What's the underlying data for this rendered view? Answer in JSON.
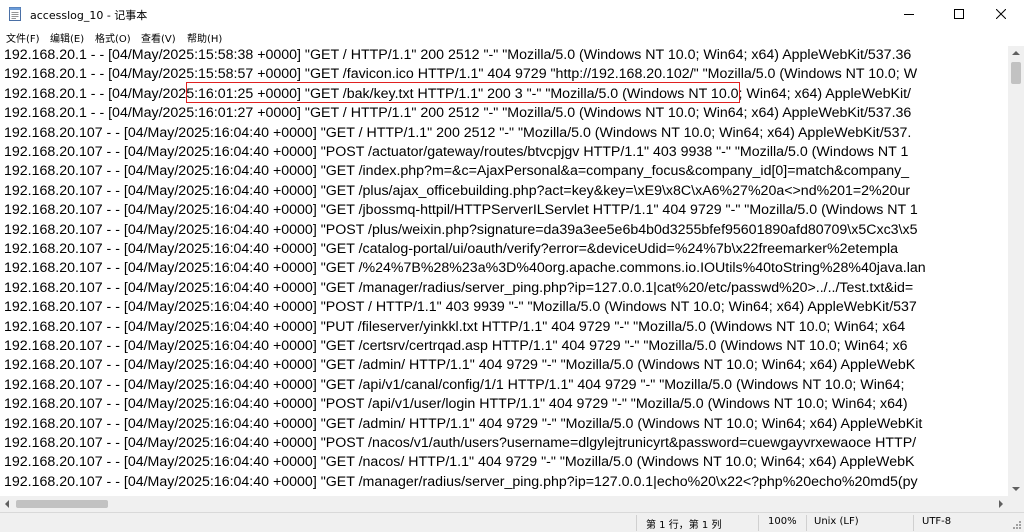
{
  "window": {
    "title": "accesslog_10 - 记事本"
  },
  "menu": [
    {
      "label": "文件(F)"
    },
    {
      "label": "编辑(E)"
    },
    {
      "label": "格式(O)"
    },
    {
      "label": "查看(V)"
    },
    {
      "label": "帮助(H)"
    }
  ],
  "editor": {
    "lines": [
      "192.168.20.1 - - [04/May/2025:15:58:38 +0000] \"GET / HTTP/1.1\" 200 2512 \"-\" \"Mozilla/5.0 (Windows NT 10.0; Win64; x64) AppleWebKit/537.36",
      "192.168.20.1 - - [04/May/2025:15:58:57 +0000] \"GET /favicon.ico HTTP/1.1\" 404 9729 \"http://192.168.20.102/\" \"Mozilla/5.0 (Windows NT 10.0; W",
      "192.168.20.1 - - [04/May/2025:16:01:25 +0000] \"GET /bak/key.txt HTTP/1.1\" 200 3 \"-\" \"Mozilla/5.0 (Windows NT 10.0; Win64; x64) AppleWebKit/",
      "192.168.20.1 - - [04/May/2025:16:01:27 +0000] \"GET / HTTP/1.1\" 200 2512 \"-\" \"Mozilla/5.0 (Windows NT 10.0; Win64; x64) AppleWebKit/537.36",
      "192.168.20.107 - - [04/May/2025:16:04:40 +0000] \"GET / HTTP/1.1\" 200 2512 \"-\" \"Mozilla/5.0 (Windows NT 10.0; Win64; x64) AppleWebKit/537.",
      "192.168.20.107 - - [04/May/2025:16:04:40 +0000] \"POST /actuator/gateway/routes/btvcpjgv HTTP/1.1\" 403 9938 \"-\" \"Mozilla/5.0 (Windows NT 1",
      "192.168.20.107 - - [04/May/2025:16:04:40 +0000] \"GET /index.php?m=&c=AjaxPersonal&a=company_focus&company_id[0]=match&company_",
      "192.168.20.107 - - [04/May/2025:16:04:40 +0000] \"GET /plus/ajax_officebuilding.php?act=key&key=\\xE9\\x8C\\xA6%27%20a<>nd%201=2%20ur",
      "192.168.20.107 - - [04/May/2025:16:04:40 +0000] \"GET /jbossmq-httpil/HTTPServerILServlet HTTP/1.1\" 404 9729 \"-\" \"Mozilla/5.0 (Windows NT 1",
      "192.168.20.107 - - [04/May/2025:16:04:40 +0000] \"POST /plus/weixin.php?signature=da39a3ee5e6b4b0d3255bfef95601890afd80709\\x5Cxc3\\x5",
      "192.168.20.107 - - [04/May/2025:16:04:40 +0000] \"GET /catalog-portal/ui/oauth/verify?error=&deviceUdid=%24%7b\\x22freemarker%2etempla",
      "192.168.20.107 - - [04/May/2025:16:04:40 +0000] \"GET /%24%7B%28%23a%3D%40org.apache.commons.io.IOUtils%40toString%28%40java.lan",
      "192.168.20.107 - - [04/May/2025:16:04:40 +0000] \"GET /manager/radius/server_ping.php?ip=127.0.0.1|cat%20/etc/passwd%20>../../Test.txt&id=",
      "192.168.20.107 - - [04/May/2025:16:04:40 +0000] \"POST / HTTP/1.1\" 403 9939 \"-\" \"Mozilla/5.0 (Windows NT 10.0; Win64; x64) AppleWebKit/537",
      "192.168.20.107 - - [04/May/2025:16:04:40 +0000] \"PUT /fileserver/yinkkl.txt HTTP/1.1\" 404 9729 \"-\" \"Mozilla/5.0 (Windows NT 10.0; Win64; x64",
      "192.168.20.107 - - [04/May/2025:16:04:40 +0000] \"GET /certsrv/certrqad.asp HTTP/1.1\" 404 9729 \"-\" \"Mozilla/5.0 (Windows NT 10.0; Win64; x6",
      "192.168.20.107 - - [04/May/2025:16:04:40 +0000] \"GET /admin/ HTTP/1.1\" 404 9729 \"-\" \"Mozilla/5.0 (Windows NT 10.0; Win64; x64) AppleWebK",
      "192.168.20.107 - - [04/May/2025:16:04:40 +0000] \"GET /api/v1/canal/config/1/1 HTTP/1.1\" 404 9729 \"-\" \"Mozilla/5.0 (Windows NT 10.0; Win64;",
      "192.168.20.107 - - [04/May/2025:16:04:40 +0000] \"POST /api/v1/user/login HTTP/1.1\" 404 9729 \"-\" \"Mozilla/5.0 (Windows NT 10.0; Win64; x64)",
      "192.168.20.107 - - [04/May/2025:16:04:40 +0000] \"GET /admin/ HTTP/1.1\" 404 9729 \"-\" \"Mozilla/5.0 (Windows NT 10.0; Win64; x64) AppleWebKit",
      "192.168.20.107 - - [04/May/2025:16:04:40 +0000] \"POST /nacos/v1/auth/users?username=dlgylejtrunicyrt&password=cuewgayvrxewaoce HTTP/",
      "192.168.20.107 - - [04/May/2025:16:04:40 +0000] \"GET /nacos/ HTTP/1.1\" 404 9729 \"-\" \"Mozilla/5.0 (Windows NT 10.0; Win64; x64) AppleWebK",
      "192.168.20.107 - - [04/May/2025:16:04:40 +0000] \"GET /manager/radius/server_ping.php?ip=127.0.0.1|echo%20\\x22<?php%20echo%20md5(py"
    ],
    "highlight_color": "#e02020"
  },
  "status": {
    "position": "第 1 行，第 1 列",
    "zoom": "100%",
    "line_ending": "Unix (LF)",
    "encoding": "UTF-8"
  }
}
